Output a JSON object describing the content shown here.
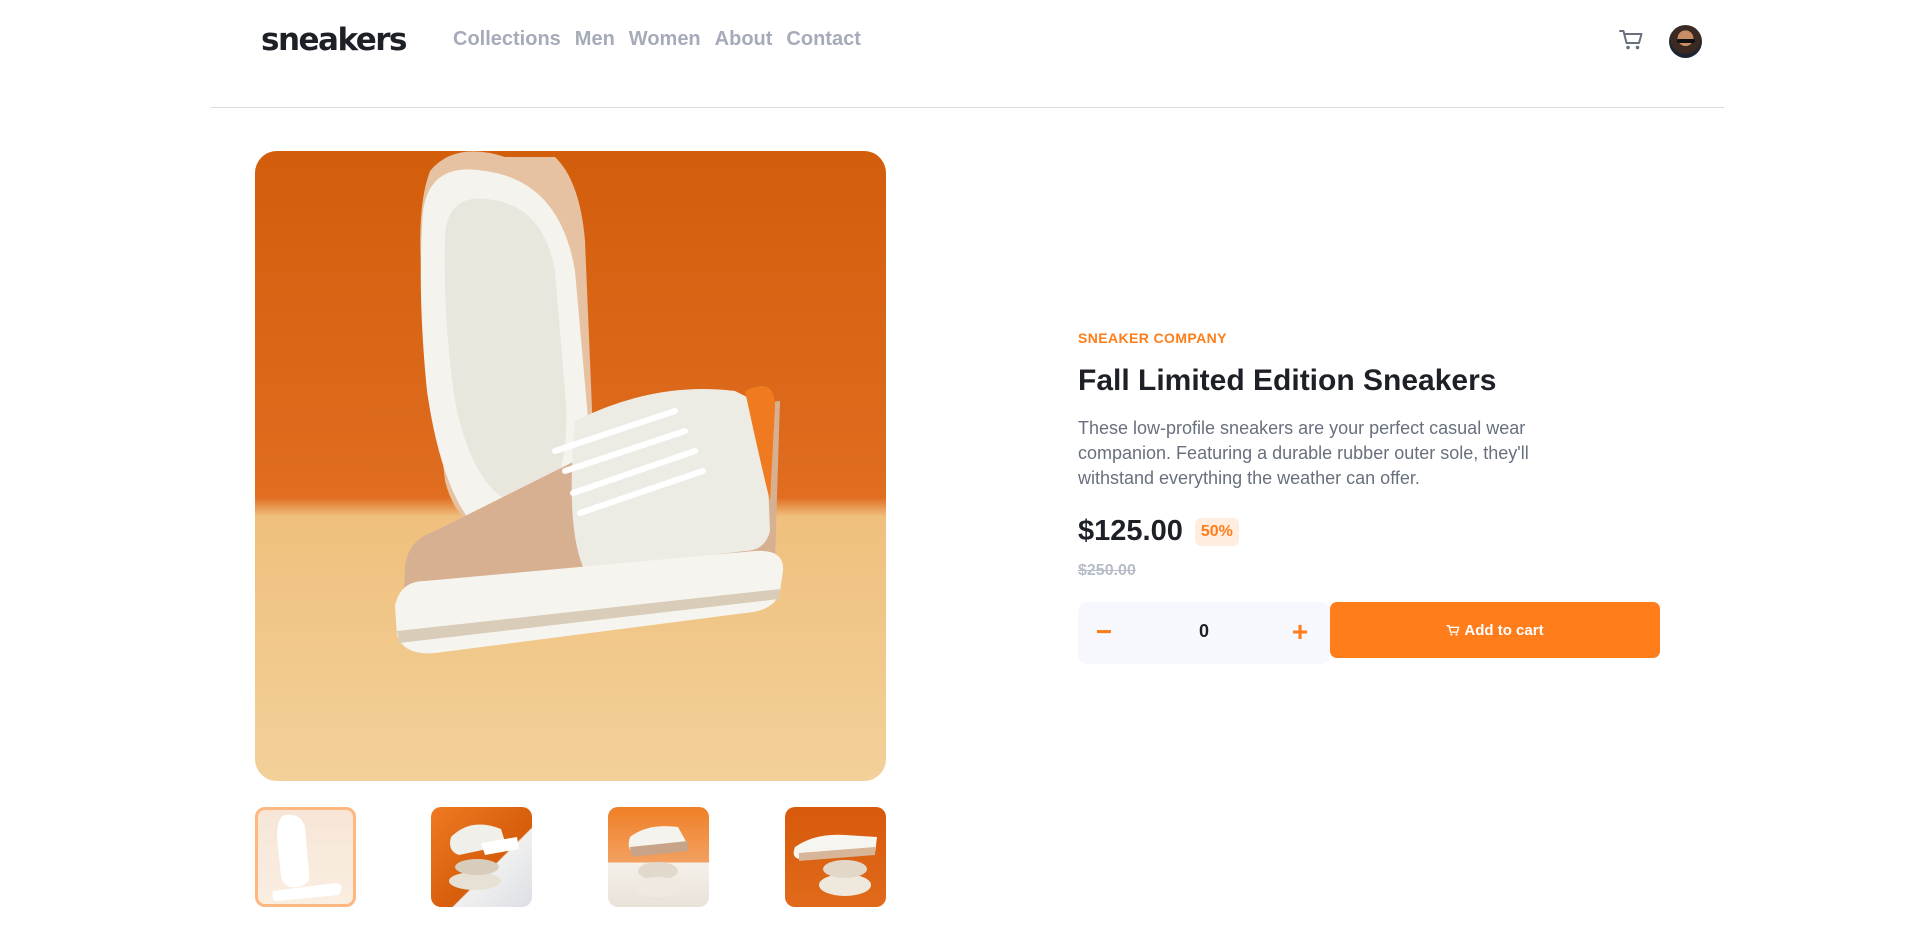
{
  "header": {
    "logo": "sneakers",
    "nav": [
      "Collections",
      "Men",
      "Women",
      "About",
      "Contact"
    ],
    "cart_icon": "cart-icon",
    "avatar_icon": "avatar"
  },
  "product": {
    "company": "SNEAKER COMPANY",
    "title": "Fall Limited Edition Sneakers",
    "description": "These low-profile sneakers are your perfect casual wear companion. Featuring a durable rubber outer sole, they'll withstand everything the weather can offer.",
    "price": "$125.00",
    "discount": "50%",
    "original_price": "$250.00",
    "quantity": "0",
    "minus_label": "−",
    "plus_label": "+",
    "add_to_cart_label": "Add to cart"
  },
  "gallery": {
    "selected_index": 0,
    "thumbnail_count": 4
  },
  "colors": {
    "accent": "#ff7d1a",
    "accent_pale": "#ffede0",
    "dark": "#1d2026",
    "muted": "#68707d"
  }
}
